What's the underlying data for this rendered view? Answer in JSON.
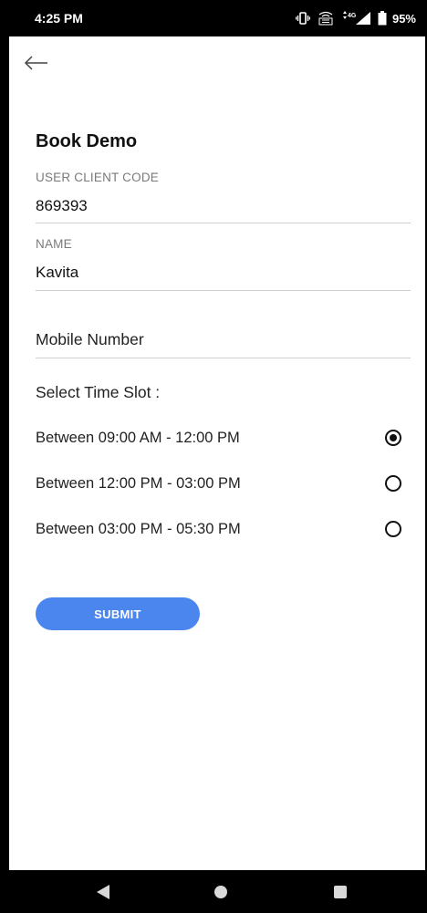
{
  "status_bar": {
    "time": "4:25 PM",
    "battery": "95%",
    "icons": [
      "vibrate-icon",
      "volte-icon",
      "signal-4g-icon",
      "battery-icon"
    ]
  },
  "header": {
    "back_icon": "arrow-left-icon"
  },
  "form": {
    "title": "Book Demo",
    "client_code": {
      "label": "USER CLIENT CODE",
      "value": "869393"
    },
    "name": {
      "label": "NAME",
      "value": "Kavita"
    },
    "mobile": {
      "placeholder": "Mobile Number"
    },
    "time_slot": {
      "heading": "Select Time Slot :",
      "options": [
        {
          "label": "Between 09:00 AM - 12:00 PM",
          "selected": true
        },
        {
          "label": "Between 12:00 PM - 03:00 PM",
          "selected": false
        },
        {
          "label": "Between 03:00 PM - 05:30 PM",
          "selected": false
        }
      ]
    },
    "submit_label": "SUBMIT"
  },
  "colors": {
    "accent": "#4a86ee",
    "divider": "#cfcfcf",
    "label": "#7a7a7a"
  },
  "nav_bar": {
    "icons": [
      "nav-back-icon",
      "nav-home-icon",
      "nav-recents-icon"
    ]
  }
}
